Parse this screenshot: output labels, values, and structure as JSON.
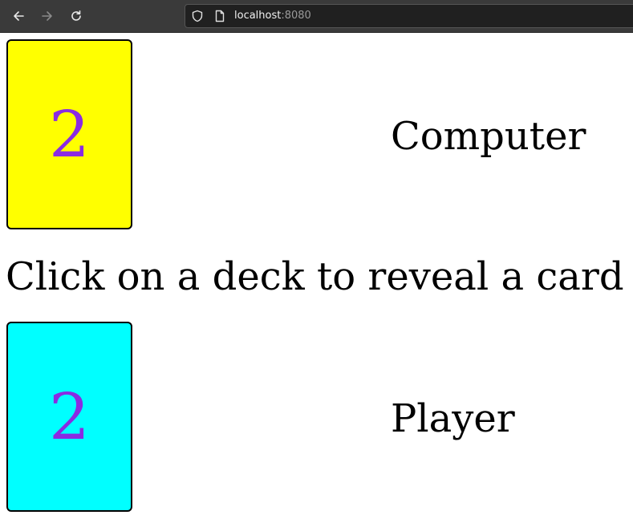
{
  "browser": {
    "url_host": "localhost",
    "url_port": ":8080"
  },
  "computer": {
    "label": "Computer",
    "card_value": "2",
    "card_color": "#ffff00"
  },
  "instructions": "Click on a deck to reveal a card",
  "player": {
    "label": "Player",
    "card_value": "2",
    "card_color": "#00ffff"
  },
  "colors": {
    "card_text": "#8a2be2"
  }
}
